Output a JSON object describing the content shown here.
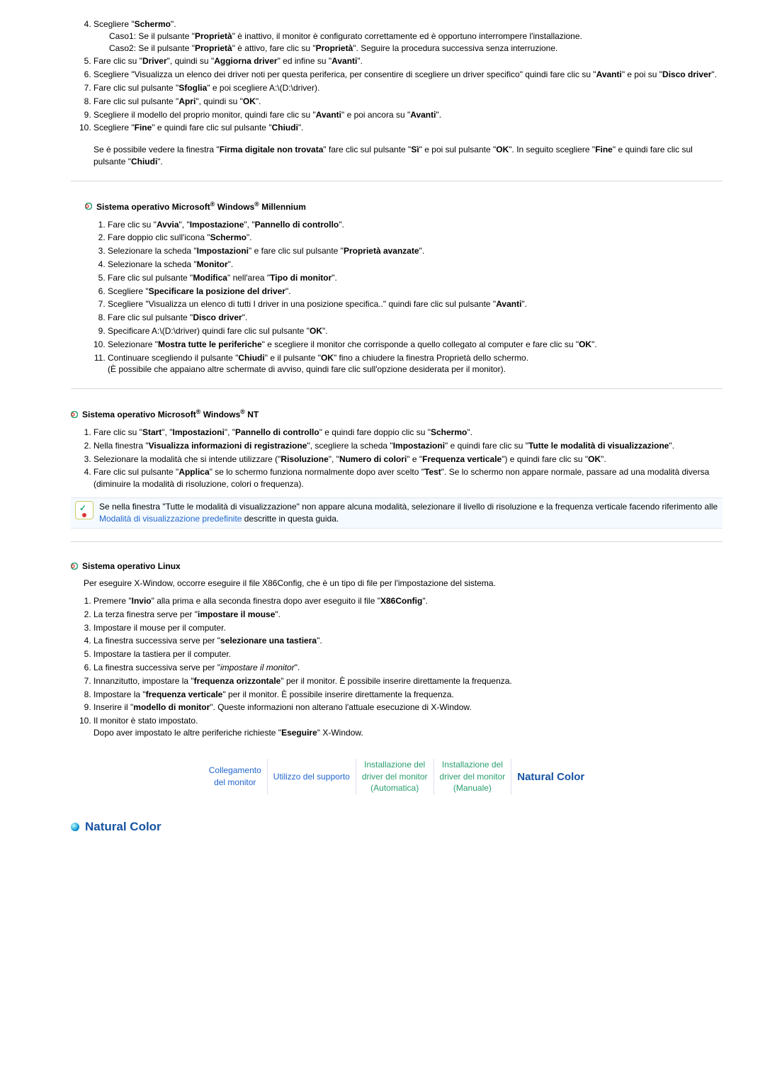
{
  "section1": {
    "items": {
      "4": "Scegliere \"",
      "4b": "Schermo",
      "4c": "\".",
      "4case1": "Caso1: Se il pulsante \"",
      "4prop1": "Proprietà",
      "4case1b": "\" è inattivo, il monitor è configurato correttamente ed è opportuno interrompere l'installazione.",
      "4case2": "Caso2: Se il pulsante \"",
      "4prop2": "Proprietà",
      "4case2b": "\" è attivo, fare clic su \"",
      "4prop3": "Proprietà",
      "4case2c": "\". Seguire la procedura successiva senza interruzione.",
      "5a": "Fare clic su \"",
      "5b": "Driver",
      "5c": "\", quindi su \"",
      "5d": "Aggiorna driver",
      "5e": "\" ed infine su \"",
      "5f": "Avanti",
      "5g": "\".",
      "6a": "Scegliere \"Visualizza un elenco dei driver noti per questa periferica, per consentire di scegliere un driver specifico\" quindi fare clic su \"",
      "6b": "Avanti",
      "6c": "\" e poi su \"",
      "6d": "Disco driver",
      "6e": "\".",
      "7a": "Fare clic sul pulsante \"",
      "7b": "Sfoglia",
      "7c": "\" e poi scegliere A:\\(D:\\driver).",
      "8a": "Fare clic sul pulsante \"",
      "8b": "Apri",
      "8c": "\", quindi su \"",
      "8d": "OK",
      "8e": "\".",
      "9a": "Scegliere il modello del proprio monitor, quindi fare clic su \"",
      "9b": "Avanti",
      "9c": "\" e poi ancora su \"",
      "9d": "Avanti",
      "9e": "\".",
      "10a": "Scegliere \"",
      "10b": "Fine",
      "10c": "\" e quindi fare clic sul pulsante \"",
      "10d": "Chiudi",
      "10e": "\".",
      "post1": "Se è possibile vedere la finestra \"",
      "post2": "Firma digitale non trovata",
      "post3": "\" fare clic sul pulsante \"",
      "post4": "Sì",
      "post5": "\" e poi sul pulsante \"",
      "post6": "OK",
      "post7": "\". In seguito scegliere \"",
      "post8": "Fine",
      "post9": "\" e quindi fare clic sul pulsante \"",
      "post10": "Chiudi",
      "post11": "\"."
    }
  },
  "section2": {
    "title_a": "Sistema operativo Microsoft",
    "title_b": " Windows",
    "title_c": " Millennium",
    "items": {
      "1a": "Fare clic su \"",
      "1b": "Avvia",
      "1c": "\", \"",
      "1d": "Impostazione",
      "1e": "\", \"",
      "1f": "Pannello di controllo",
      "1g": "\".",
      "2a": "Fare doppio clic sull'icona \"",
      "2b": "Schermo",
      "2c": "\".",
      "3a": "Selezionare la scheda \"",
      "3b": "Impostazioni",
      "3c": "\" e fare clic sul pulsante \"",
      "3d": "Proprietà avanzate",
      "3e": "\".",
      "4a": "Selezionare la scheda \"",
      "4b": "Monitor",
      "4c": "\".",
      "5a": "Fare clic sul pulsante \"",
      "5b": "Modifica",
      "5c": "\" nell'area \"",
      "5d": "Tipo di monitor",
      "5e": "\".",
      "6a": "Scegliere \"",
      "6b": "Specificare la posizione del driver",
      "6c": "\".",
      "7a": "Scegliere \"Visualizza un elenco di tutti I driver in una posizione specifica..\" quindi fare clic sul pulsante \"",
      "7b": "Avanti",
      "7c": "\".",
      "8a": "Fare clic sul pulsante \"",
      "8b": "Disco driver",
      "8c": "\".",
      "9a": "Specificare A:\\(D:\\driver) quindi fare clic sul pulsante \"",
      "9b": "OK",
      "9c": "\".",
      "10a": "Selezionare \"",
      "10b": "Mostra tutte le periferiche",
      "10c": "\" e scegliere il monitor che corrisponde a quello collegato al computer e fare clic su \"",
      "10d": "OK",
      "10e": "\".",
      "11a": "Continuare scegliendo il pulsante \"",
      "11b": "Chiudi",
      "11c": "\" e il pulsante \"",
      "11d": "OK",
      "11e": "\" fino a chiudere la finestra Proprietà dello schermo.",
      "11f": "(È possibile che appaiano altre schermate di avviso, quindi fare clic sull'opzione desiderata per il monitor)."
    }
  },
  "section3": {
    "title_a": "Sistema operativo Microsoft",
    "title_b": " Windows",
    "title_c": " NT",
    "items": {
      "1a": "Fare clic su \"",
      "1b": "Start",
      "1c": "\", \"",
      "1d": "Impostazioni",
      "1e": "\", \"",
      "1f": "Pannello di controllo",
      "1g": "\" e quindi fare doppio clic su \"",
      "1h": "Schermo",
      "1i": "\".",
      "2a": "Nella finestra \"",
      "2b": "Visualizza informazioni di registrazione",
      "2c": "\", scegliere la scheda \"",
      "2d": "Impostazioni",
      "2e": "\" e quindi fare clic su \"",
      "2f": "Tutte le modalità di visualizzazione",
      "2g": "\".",
      "3a": "Selezionare la modalità che si intende utilizzare (\"",
      "3b": "Risoluzione",
      "3c": "\", \"",
      "3d": "Numero di colori",
      "3e": "\" e \"",
      "3f": "Frequenza verticale",
      "3g": "\") e quindi fare clic su \"",
      "3h": "OK",
      "3i": "\".",
      "4a": "Fare clic sul pulsante \"",
      "4b": "Applica",
      "4c": "\" se lo schermo funziona normalmente dopo aver scelto \"",
      "4d": "Test",
      "4e": "\". Se lo schermo non appare normale, passare ad una modalità diversa (diminuire la modalità di risoluzione, colori o frequenza)."
    },
    "note_a": "Se nella finestra \"Tutte le modalità di visualizzazione\" non appare alcuna modalità, selezionare il livello di risoluzione e la frequenza verticale facendo riferimento alle ",
    "note_link": "Modalità di visualizzazione predefinite",
    "note_b": " descritte in questa guida."
  },
  "section4": {
    "title": "Sistema operativo Linux",
    "intro": "Per eseguire X-Window, occorre eseguire il file X86Config, che è un tipo di file per l'impostazione del sistema.",
    "items": {
      "1a": "Premere \"",
      "1b": "Invio",
      "1c": "\" alla prima e alla seconda finestra dopo aver eseguito il file \"",
      "1d": "X86Config",
      "1e": "\".",
      "2a": "La terza finestra serve per \"",
      "2b": "impostare il mouse",
      "2c": "\".",
      "3a": "Impostare il mouse per il computer.",
      "4a": "La finestra successiva serve per \"",
      "4b": "selezionare una tastiera",
      "4c": "\".",
      "5a": "Impostare la tastiera per il computer.",
      "6a": "La finestra successiva serve per \"",
      "6i": "impostare il monitor",
      "6c": "\".",
      "7a": "Innanzitutto, impostare la \"",
      "7b": "frequenza orizzontale",
      "7c": "\" per il monitor. È possibile inserire direttamente la frequenza.",
      "8a": "Impostare la \"",
      "8b": "frequenza verticale",
      "8c": "\" per il monitor. È possibile inserire direttamente la frequenza.",
      "9a": "Inserire il \"",
      "9b": "modello di monitor",
      "9c": "\". Queste informazioni non alterano l'attuale esecuzione di X-Window.",
      "10a": "Il monitor è stato impostato.",
      "10b": "Dopo aver impostato le altre periferiche richieste \"",
      "10c": "Eseguire",
      "10d": "\" X-Window."
    }
  },
  "nav": {
    "c1a": "Collegamento",
    "c1b": "del monitor",
    "c2": "Utilizzo del supporto",
    "c3a": "Installazione del",
    "c3b": "driver del monitor",
    "c3c": "(Automatica)",
    "c4a": "Installazione del",
    "c4b": "driver del monitor",
    "c4c": "(Manuale)",
    "c5": "Natural Color"
  },
  "bottom_title": "Natural Color"
}
